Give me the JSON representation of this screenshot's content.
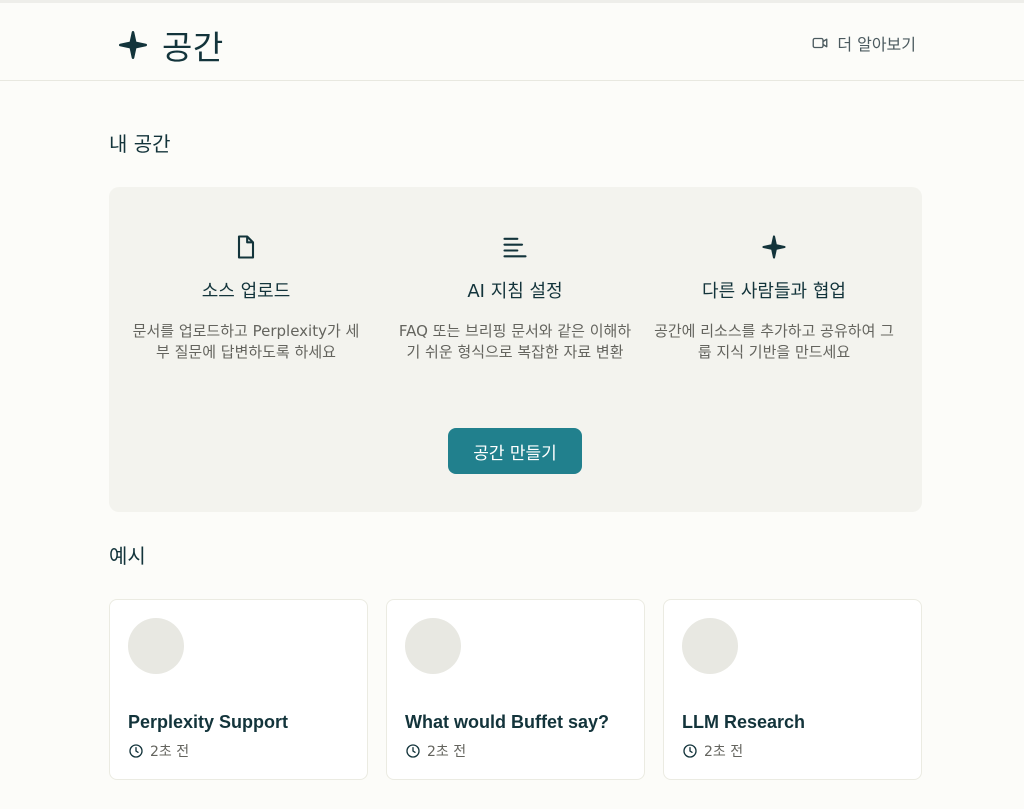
{
  "header": {
    "title": "공간",
    "learn_more": "더 알아보기"
  },
  "my_spaces": {
    "title": "내 공간",
    "features": [
      {
        "icon": "document-icon",
        "name": "소스 업로드",
        "description": "문서를 업로드하고 Perplexity가 세부 질문에 답변하도록 하세요"
      },
      {
        "icon": "lines-icon",
        "name": "AI 지침 설정",
        "description": "FAQ 또는 브리핑 문서와 같은 이해하기 쉬운 형식으로 복잡한 자료 변환"
      },
      {
        "icon": "sparkle-icon",
        "name": "다른 사람들과 협업",
        "description": "공간에 리소스를 추가하고 공유하여 그룹 지식 기반을 만드세요"
      }
    ],
    "create_button": "공간 만들기"
  },
  "examples": {
    "title": "예시",
    "cards": [
      {
        "title": "Perplexity Support",
        "time": "2초 전"
      },
      {
        "title": "What would Buffet say?",
        "time": "2초 전"
      },
      {
        "title": "LLM Research",
        "time": "2초 전"
      }
    ]
  },
  "colors": {
    "accent": "#21808d",
    "background": "#fcfcf9",
    "panel": "#f3f3ee",
    "text": "#13343b"
  }
}
